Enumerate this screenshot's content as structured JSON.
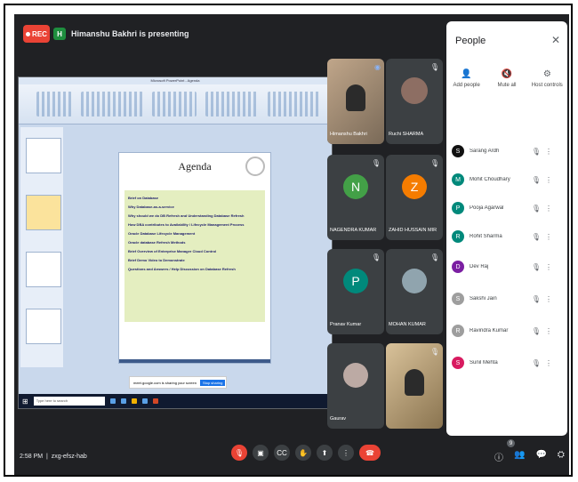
{
  "header": {
    "rec_label": "REC",
    "presenter_initial": "H",
    "presenter_text": "Himanshu Bakhri is presenting"
  },
  "slide": {
    "window_title": "Microsoft PowerPoint - Agenda",
    "title": "Agenda",
    "bullets": [
      "Brief on Database",
      "Why Database-as-a-service",
      "Why should we do DB Refresh and Understanding Database Refresh",
      "How DBA contributes to Availability / Lifecycle Management Process",
      "Oracle Database Lifecycle Management",
      "Oracle database Refresh Methods",
      "Brief Overview of Enterprise Manager Cloud Control",
      "Brief Demo Video to Demonstrate",
      "Questions and Answers / Help Discussion on Database Refresh"
    ],
    "share_bar_text": "meet.google.com is sharing your screen",
    "share_bar_button": "Stop sharing",
    "taskbar_search": "Type here to search"
  },
  "tiles": [
    {
      "name": "Himanshu Bakhri",
      "kind": "video"
    },
    {
      "name": "Ruchi SHARMA",
      "kind": "photo"
    },
    {
      "name": "NAGENDRA KUMAR",
      "kind": "avatar",
      "initial": "N",
      "color": "#43a047"
    },
    {
      "name": "ZAHID HUSSAIN MIR",
      "kind": "avatar",
      "initial": "Z",
      "color": "#f57c00"
    },
    {
      "name": "Pranav Kumar",
      "kind": "avatar",
      "initial": "P",
      "color": "#00897b"
    },
    {
      "name": "MOHAN KUMAR",
      "kind": "photo"
    },
    {
      "name": "Gaurav",
      "kind": "photo"
    },
    {
      "name": "",
      "kind": "video"
    }
  ],
  "people": {
    "title": "People",
    "actions": [
      {
        "label": "Add people",
        "icon": "add-person-icon"
      },
      {
        "label": "Mute all",
        "icon": "mute-all-icon"
      },
      {
        "label": "Host controls",
        "icon": "host-controls-icon"
      }
    ],
    "participants": [
      {
        "name": "Sarang Ardh",
        "initial": "S",
        "color": "#111111"
      },
      {
        "name": "Mohit Choudhary",
        "initial": "M",
        "color": "#00897b"
      },
      {
        "name": "Pooja Agarwal",
        "initial": "P",
        "color": "#00897b"
      },
      {
        "name": "Rohit Sharma",
        "initial": "R",
        "color": "#00897b"
      },
      {
        "name": "Dev Raj",
        "initial": "D",
        "color": "#7b1fa2"
      },
      {
        "name": "Sakshi Jain",
        "initial": "S",
        "color": "#9e9e9e"
      },
      {
        "name": "Ravindra Kumar",
        "initial": "R",
        "color": "#9e9e9e"
      },
      {
        "name": "Sunil Mehta",
        "initial": "S",
        "color": "#d81b60"
      }
    ]
  },
  "footer": {
    "time": "2:58 PM",
    "meeting_code": "zxg-efsz-hab",
    "people_count": "9"
  }
}
